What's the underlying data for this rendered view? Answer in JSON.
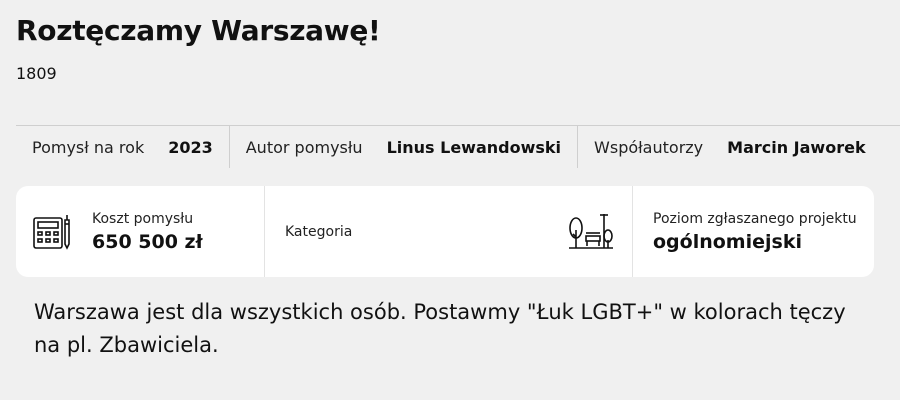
{
  "project": {
    "title": "Roztęczamy Warszawę!",
    "id": "1809"
  },
  "meta": {
    "year_label": "Pomysł na rok",
    "year_value": "2023",
    "author_label": "Autor pomysłu",
    "author_value": "Linus Lewandowski",
    "coauthors_label": "Współautorzy",
    "coauthors_value": "Marcin Jaworek"
  },
  "details": {
    "cost_label": "Koszt pomysłu",
    "cost_value": "650 500 zł",
    "cost_icon": "calculator-icon",
    "category_label": "Kategoria",
    "category_icon": "park-icon",
    "level_label": "Poziom zgłaszanego projektu",
    "level_value": "ogólnomiejski"
  },
  "description": "Warszawa jest dla wszystkich osób. Postawmy \"Łuk LGBT+\" w kolorach tęczy na pl. Zbawiciela."
}
